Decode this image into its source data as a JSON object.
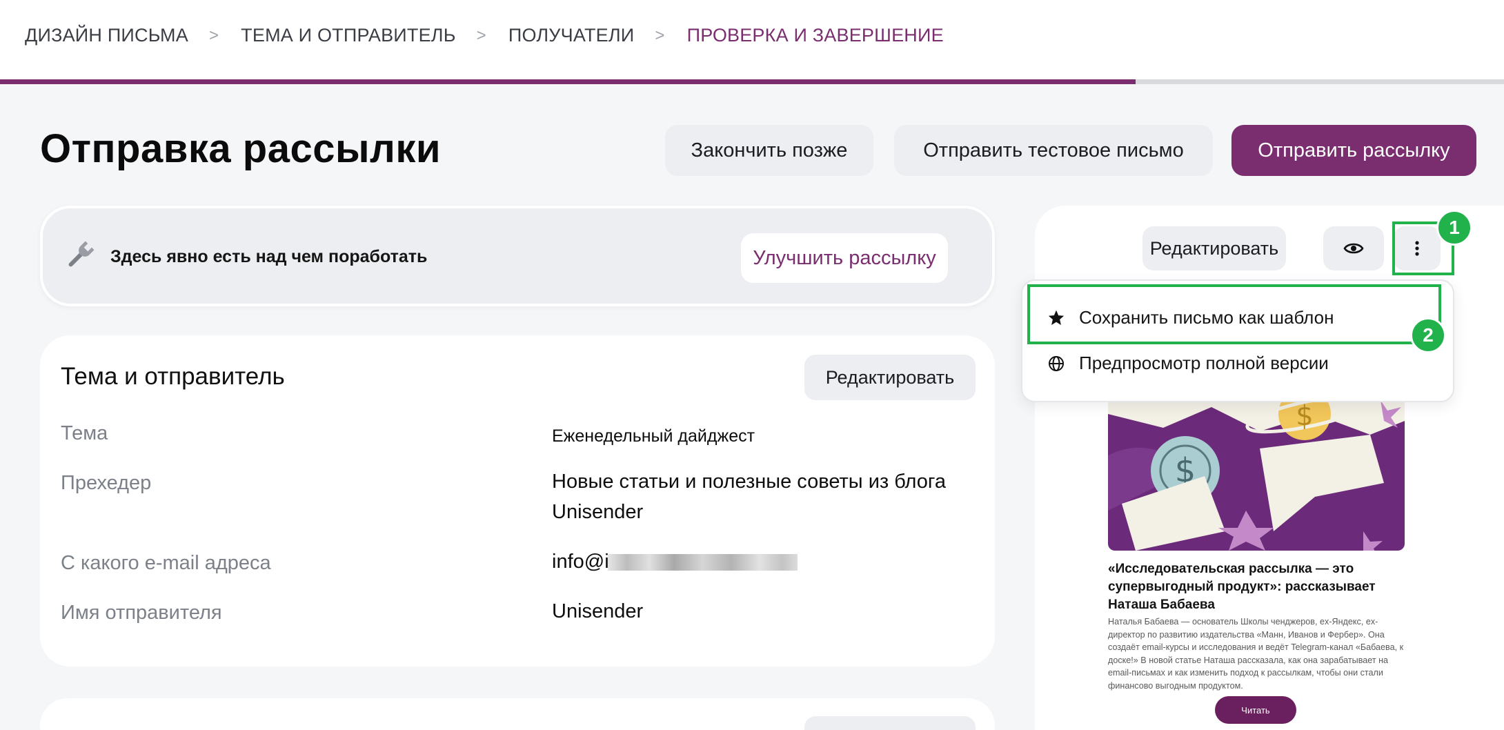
{
  "stepper": {
    "steps": [
      "ДИЗАЙН ПИСЬМА",
      "ТЕМА И ОТПРАВИТЕЛЬ",
      "ПОЛУЧАТЕЛИ",
      "ПРОВЕРКА И ЗАВЕРШЕНИЕ"
    ],
    "active_step": 3,
    "progress_fraction": 0.755
  },
  "header": {
    "title": "Отправка рассылки",
    "finish_later": "Закончить позже",
    "send_test": "Отправить тестовое письмо",
    "send": "Отправить рассылку"
  },
  "hint": {
    "icon": "wrench-icon",
    "text": "Здесь явно есть над чем поработать",
    "button": "Улучшить рассылку"
  },
  "theme_card": {
    "title": "Тема и отправитель",
    "edit": "Редактировать",
    "rows": [
      {
        "label": "Тема",
        "value": "Еженедельный дайджест"
      },
      {
        "label": "Прехедер",
        "value": "Новые статьи и полезные советы из блога Unisender"
      },
      {
        "label": "С какого e-mail адреса",
        "value": "info@i"
      },
      {
        "label": "Имя отправителя",
        "value": "Unisender"
      }
    ]
  },
  "preview": {
    "edit": "Редактировать",
    "eye_icon": "eye-icon",
    "more_icon": "more-vertical-icon",
    "menu": [
      {
        "icon": "star-icon",
        "label": "Сохранить письмо как шаблон"
      },
      {
        "icon": "globe-icon",
        "label": "Предпросмотр полной версии"
      }
    ],
    "email": {
      "title": "«Исследовательская рассылка — это супервыгодный продукт»: рассказывает Наташа Бабаева",
      "body": "Наталья Бабаева — основатель Школы ченджеров, ex-Яндекс, ex-директор по развитию издательства «Манн, Иванов и Фербер». Она создаёт email-курсы и исследования и ведёт Telegram-канал «Бабаева, к доске!» В новой статье Наташа рассказала, как она зарабатывает на email-письмах и как изменить подход к рассылкам, чтобы они стали финансово выгодным продуктом.",
      "button": "Читать"
    }
  },
  "annotations": {
    "badge1": "1",
    "badge2": "2"
  },
  "colors": {
    "accent": "#7a2d6f",
    "highlight": "#22b24c",
    "background": "#f5f6f8"
  }
}
